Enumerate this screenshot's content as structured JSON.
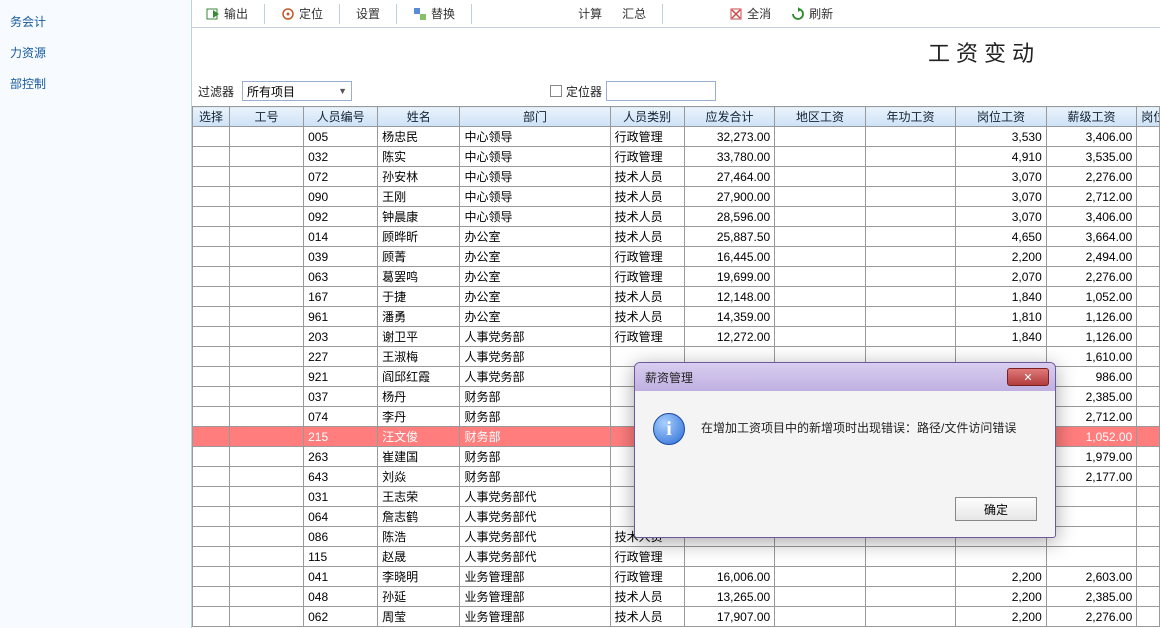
{
  "sidebar": {
    "items": [
      {
        "label": "务会计"
      },
      {
        "label": "力资源"
      },
      {
        "label": "部控制"
      }
    ]
  },
  "toolbar": {
    "export": "输出",
    "locate": "定位",
    "settings": "设置",
    "replace": "替换",
    "calc": "计算",
    "summary": "汇总",
    "clear": "全消",
    "refresh": "刷新"
  },
  "page": {
    "title": "工资变动"
  },
  "filter": {
    "label": "过滤器",
    "value": "所有项目",
    "locator_label": "定位器",
    "locator_value": ""
  },
  "columns": [
    "选择",
    "工号",
    "人员编号",
    "姓名",
    "部门",
    "人员类别",
    "应发合计",
    "地区工资",
    "年功工资",
    "岗位工资",
    "薪级工资",
    "岗位"
  ],
  "rows": [
    {
      "id": "005",
      "name": "杨忠民",
      "dept": "中心领导",
      "cat": "行政管理",
      "total": "32,273.00",
      "area": "",
      "seniority": "",
      "post": "3,530",
      "grade": "3,406.00"
    },
    {
      "id": "032",
      "name": "陈实",
      "dept": "中心领导",
      "cat": "行政管理",
      "total": "33,780.00",
      "area": "",
      "seniority": "",
      "post": "4,910",
      "grade": "3,535.00"
    },
    {
      "id": "072",
      "name": "孙安林",
      "dept": "中心领导",
      "cat": "技术人员",
      "total": "27,464.00",
      "area": "",
      "seniority": "",
      "post": "3,070",
      "grade": "2,276.00"
    },
    {
      "id": "090",
      "name": "王刚",
      "dept": "中心领导",
      "cat": "技术人员",
      "total": "27,900.00",
      "area": "",
      "seniority": "",
      "post": "3,070",
      "grade": "2,712.00"
    },
    {
      "id": "092",
      "name": "钟晨康",
      "dept": "中心领导",
      "cat": "技术人员",
      "total": "28,596.00",
      "area": "",
      "seniority": "",
      "post": "3,070",
      "grade": "3,406.00"
    },
    {
      "id": "014",
      "name": "顾晔昕",
      "dept": "办公室",
      "cat": "技术人员",
      "total": "25,887.50",
      "area": "",
      "seniority": "",
      "post": "4,650",
      "grade": "3,664.00"
    },
    {
      "id": "039",
      "name": "顾菁",
      "dept": "办公室",
      "cat": "行政管理",
      "total": "16,445.00",
      "area": "",
      "seniority": "",
      "post": "2,200",
      "grade": "2,494.00"
    },
    {
      "id": "063",
      "name": "葛罢鸣",
      "dept": "办公室",
      "cat": "行政管理",
      "total": "19,699.00",
      "area": "",
      "seniority": "",
      "post": "2,070",
      "grade": "2,276.00"
    },
    {
      "id": "167",
      "name": "于捷",
      "dept": "办公室",
      "cat": "技术人员",
      "total": "12,148.00",
      "area": "",
      "seniority": "",
      "post": "1,840",
      "grade": "1,052.00"
    },
    {
      "id": "961",
      "name": "潘勇",
      "dept": "办公室",
      "cat": "技术人员",
      "total": "14,359.00",
      "area": "",
      "seniority": "",
      "post": "1,810",
      "grade": "1,126.00"
    },
    {
      "id": "203",
      "name": "谢卫平",
      "dept": "人事党务部",
      "cat": "行政管理",
      "total": "12,272.00",
      "area": "",
      "seniority": "",
      "post": "1,840",
      "grade": "1,126.00"
    },
    {
      "id": "227",
      "name": "王淑梅",
      "dept": "人事党务部",
      "cat": "",
      "total": "",
      "area": "",
      "seniority": "",
      "post": "",
      "grade": "1,610.00"
    },
    {
      "id": "921",
      "name": "阎邱红霞",
      "dept": "人事党务部",
      "cat": "",
      "total": "",
      "area": "",
      "seniority": "",
      "post": "",
      "grade": "986.00"
    },
    {
      "id": "037",
      "name": "杨丹",
      "dept": "财务部",
      "cat": "",
      "total": "",
      "area": "",
      "seniority": "",
      "post": "",
      "grade": "2,385.00"
    },
    {
      "id": "074",
      "name": "李丹",
      "dept": "财务部",
      "cat": "",
      "total": "",
      "area": "",
      "seniority": "",
      "post": "",
      "grade": "2,712.00"
    },
    {
      "id": "215",
      "name": "汪文俊",
      "dept": "财务部",
      "cat": "",
      "total": "",
      "area": "",
      "seniority": "",
      "post": "",
      "grade": "1,052.00",
      "selected": true
    },
    {
      "id": "263",
      "name": "崔建国",
      "dept": "财务部",
      "cat": "",
      "total": "",
      "area": "",
      "seniority": "",
      "post": "",
      "grade": "1,979.00"
    },
    {
      "id": "643",
      "name": "刘焱",
      "dept": "财务部",
      "cat": "",
      "total": "",
      "area": "",
      "seniority": "",
      "post": "",
      "grade": "2,177.00"
    },
    {
      "id": "031",
      "name": "王志荣",
      "dept": "人事党务部代",
      "cat": "",
      "total": "",
      "area": "",
      "seniority": "",
      "post": "",
      "grade": ""
    },
    {
      "id": "064",
      "name": "詹志鹤",
      "dept": "人事党务部代",
      "cat": "",
      "total": "",
      "area": "",
      "seniority": "",
      "post": "",
      "grade": ""
    },
    {
      "id": "086",
      "name": "陈浩",
      "dept": "人事党务部代",
      "cat": "技术人员",
      "total": "",
      "area": "",
      "seniority": "",
      "post": "",
      "grade": ""
    },
    {
      "id": "115",
      "name": "赵晟",
      "dept": "人事党务部代",
      "cat": "行政管理",
      "total": "",
      "area": "",
      "seniority": "",
      "post": "",
      "grade": ""
    },
    {
      "id": "041",
      "name": "李晓明",
      "dept": "业务管理部",
      "cat": "行政管理",
      "total": "16,006.00",
      "area": "",
      "seniority": "",
      "post": "2,200",
      "grade": "2,603.00"
    },
    {
      "id": "048",
      "name": "孙延",
      "dept": "业务管理部",
      "cat": "技术人员",
      "total": "13,265.00",
      "area": "",
      "seniority": "",
      "post": "2,200",
      "grade": "2,385.00"
    },
    {
      "id": "062",
      "name": "周莹",
      "dept": "业务管理部",
      "cat": "技术人员",
      "total": "17,907.00",
      "area": "",
      "seniority": "",
      "post": "2,200",
      "grade": "2,276.00"
    }
  ],
  "dialog": {
    "title": "薪资管理",
    "message": "在增加工资项目中的新增项时出现错误：路径/文件访问错误",
    "ok": "确定"
  }
}
